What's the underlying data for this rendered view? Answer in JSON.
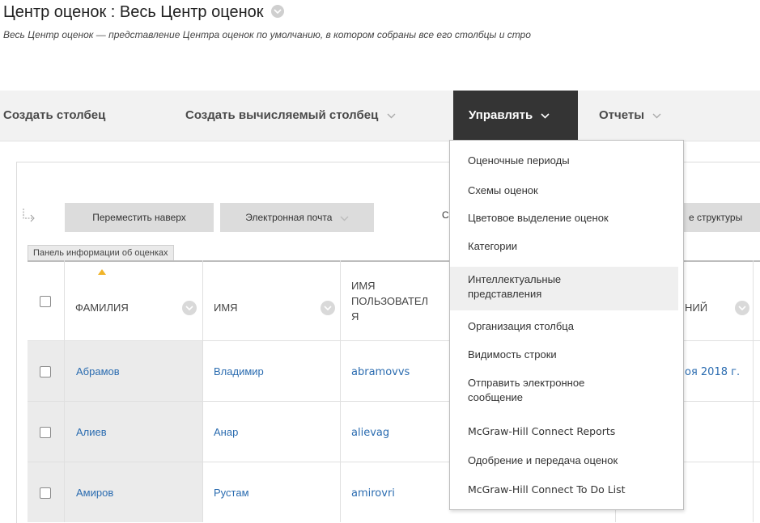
{
  "header": {
    "title": "Центр оценок : Весь Центр оценок",
    "subtitle": "Весь Центр оценок — представление Центра оценок по умолчанию, в котором собраны все его столбцы и стро"
  },
  "action_bar": {
    "create_column": "Создать столбец",
    "create_calculated": "Создать вычисляемый столбец",
    "manage": "Управлять",
    "reports": "Отчеты"
  },
  "toolbar": {
    "move_to_top": "Переместить наверх",
    "email": "Электронная почта",
    "info_panel": "Панель информации об оценках",
    "peek_left": "С",
    "peek_right": "е структуры"
  },
  "grid": {
    "headers": {
      "last_name": "ФАМИЛИЯ",
      "first_name": "ИМЯ",
      "username_l1": "ИМЯ",
      "username_l2": "ПОЛЬЗОВАТЕЛ",
      "username_l3": "Я",
      "peek_col": "НИЙ"
    },
    "rows": [
      {
        "last_name": "Абрамов",
        "first_name": "Владимир",
        "username": "abramovvs",
        "extra": "оя 2018 г."
      },
      {
        "last_name": "Алиев",
        "first_name": "Анар",
        "username": "alievag",
        "extra": ""
      },
      {
        "last_name": "Амиров",
        "first_name": "Рустам",
        "username": "amirovri",
        "extra": ""
      }
    ]
  },
  "manage_menu": {
    "items": [
      {
        "label_l1": "Оценочные периоды",
        "label_l2": ""
      },
      {
        "label_l1": "Схемы оценок",
        "label_l2": ""
      },
      {
        "label_l1": "Цветовое выделение оценок",
        "label_l2": ""
      },
      {
        "label_l1": "Категории",
        "label_l2": ""
      },
      {
        "label_l1": "Интеллектуальные",
        "label_l2": "представления"
      },
      {
        "label_l1": "Организация столбца",
        "label_l2": ""
      },
      {
        "label_l1": "Видимость строки",
        "label_l2": ""
      },
      {
        "label_l1": "Отправить электронное",
        "label_l2": "сообщение"
      },
      {
        "label_l1": "McGraw-Hill Connect Reports",
        "label_l2": ""
      },
      {
        "label_l1": "Одобрение и передача оценок",
        "label_l2": ""
      },
      {
        "label_l1": "McGraw-Hill Connect To Do List",
        "label_l2": ""
      }
    ],
    "highlighted_index": 4
  },
  "icons": {
    "dropdown": "chevron-down-icon",
    "row_arrow": "row-action-arrow-icon"
  },
  "colors": {
    "link": "#2b6cb0",
    "active_tab": "#343434",
    "sort_caret": "#f0b429"
  }
}
